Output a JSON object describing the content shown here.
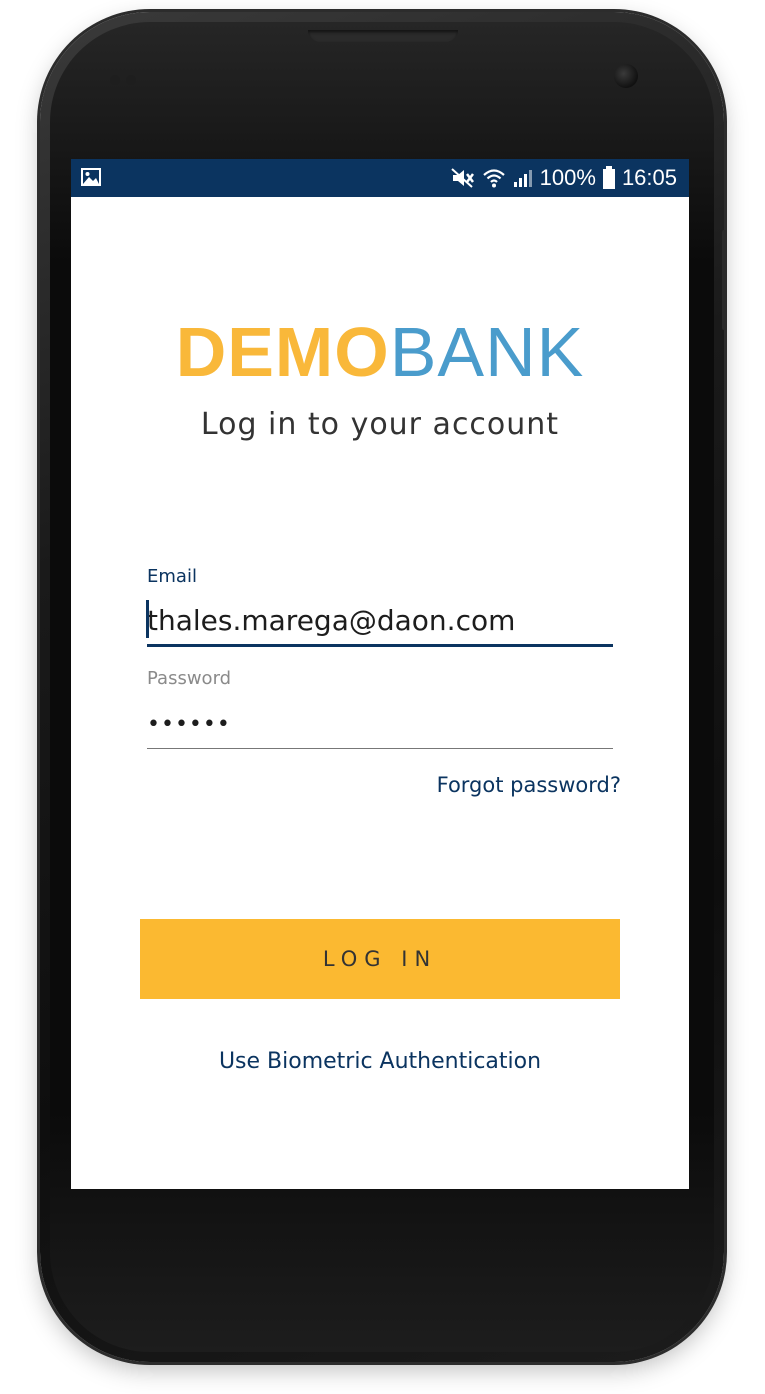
{
  "status_bar": {
    "battery_percent": "100%",
    "time": "16:05",
    "icons": [
      "gallery-icon",
      "mute-icon",
      "wifi-icon",
      "signal-icon",
      "battery-icon"
    ]
  },
  "logo": {
    "part1": "DEMO",
    "part2": "BANK",
    "colors": {
      "part1": "#f9b83a",
      "part2": "#4a9ccc"
    }
  },
  "subtitle": "Log in to your account",
  "form": {
    "email_label": "Email",
    "email_value": "thales.marega@daon.com",
    "password_label": "Password",
    "password_value": "••••••",
    "forgot_label": "Forgot password?"
  },
  "login_button_label": "LOG IN",
  "biometric_label": "Use Biometric Authentication",
  "colors": {
    "brand_navy": "#0b3460",
    "accent_yellow": "#fbb931"
  }
}
